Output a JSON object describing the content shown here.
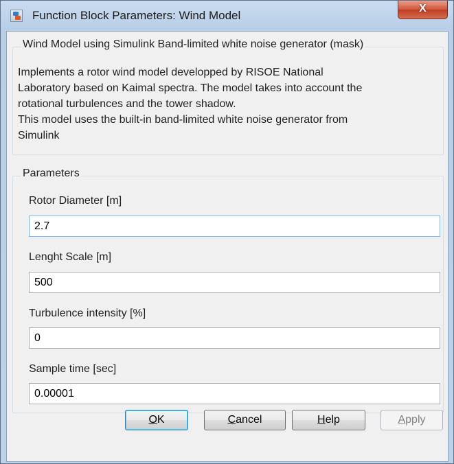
{
  "window": {
    "title": "Function Block Parameters: Wind Model",
    "close_label": "X"
  },
  "mask": {
    "group_title": "Wind Model using Simulink Band-limited white noise generator (mask)",
    "description_lines": [
      "Implements a rotor wind model developped by RISOE National",
      "Laboratory based on Kaimal spectra. The model takes into account the",
      "rotational turbulences and the tower shadow.",
      "This model uses the built-in band-limited white noise generator from",
      "Simulink"
    ]
  },
  "parameters": {
    "group_title": "Parameters",
    "fields": [
      {
        "label": "Rotor Diameter [m]",
        "value": "2.7"
      },
      {
        "label": "Lenght Scale [m]",
        "value": "500"
      },
      {
        "label": "Turbulence intensity [%]",
        "value": "0"
      },
      {
        "label": "Sample time [sec]",
        "value": "0.00001"
      }
    ]
  },
  "buttons": {
    "ok": {
      "label": "OK",
      "mnemonic": "O",
      "rest": "K"
    },
    "cancel": {
      "label": "Cancel",
      "mnemonic": "C",
      "rest": "ancel"
    },
    "help": {
      "label": "Help",
      "mnemonic": "H",
      "rest": "elp"
    },
    "apply": {
      "label": "Apply",
      "mnemonic": "A",
      "rest": "pply"
    }
  },
  "icons": {
    "window_icon": "simulink-block-icon",
    "close": "close-icon"
  }
}
